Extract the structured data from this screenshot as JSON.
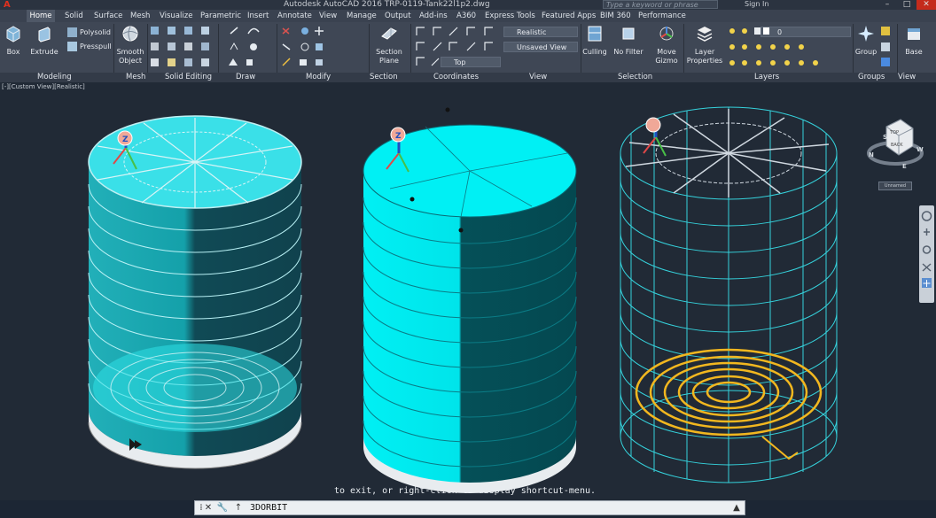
{
  "window": {
    "title": "Autodesk AutoCAD 2016   TRP-0119-Tank22l1p2.dwg",
    "search_placeholder": "Type a keyword or phrase",
    "sign_in": "Sign In"
  },
  "tabs": [
    "Home",
    "Solid",
    "Surface",
    "Mesh",
    "Visualize",
    "Parametric",
    "Insert",
    "Annotate",
    "View",
    "Manage",
    "Output",
    "Add-ins",
    "A360",
    "Express Tools",
    "Featured Apps",
    "BIM 360",
    "Performance"
  ],
  "active_tab": "Home",
  "ribbon": {
    "box": "Box",
    "extrude": "Extrude",
    "polysolid": "Polysolid",
    "presspull": "Presspull",
    "smooth_object_line1": "Smooth",
    "smooth_object_line2": "Object",
    "section_plane_line1": "Section",
    "section_plane_line2": "Plane",
    "visual_style": "Realistic",
    "named_view": "Unsaved View",
    "ucs_view": "Top",
    "culling": "Culling",
    "no_filter": "No Filter",
    "move_gizmo_line1": "Move",
    "move_gizmo_line2": "Gizmo",
    "layer_properties_line1": "Layer",
    "layer_properties_line2": "Properties",
    "layer_current": "0",
    "group": "Group",
    "base": "Base"
  },
  "panels": [
    "Modeling",
    "Mesh",
    "Solid Editing",
    "Draw",
    "Modify",
    "Section",
    "Coordinates",
    "View",
    "Selection",
    "Layers",
    "Groups",
    "View"
  ],
  "viewport": {
    "label": "[-][Custom View][Realistic]",
    "viewcube_top": "TOP",
    "viewcube_back": "BACK",
    "ucs_name": "Unnamed",
    "compass": [
      "N",
      "W",
      "E",
      "S"
    ]
  },
  "command": {
    "hint": "to exit, or right-click to display shortcut-menu.",
    "current": "3DORBIT"
  },
  "colors": {
    "viewport_bg": "#212a36",
    "tank_fill": "#00e8ee",
    "wire": "#3fd8e0",
    "coil": "#f2b71f",
    "ribbon_bg": "#3f4755"
  }
}
